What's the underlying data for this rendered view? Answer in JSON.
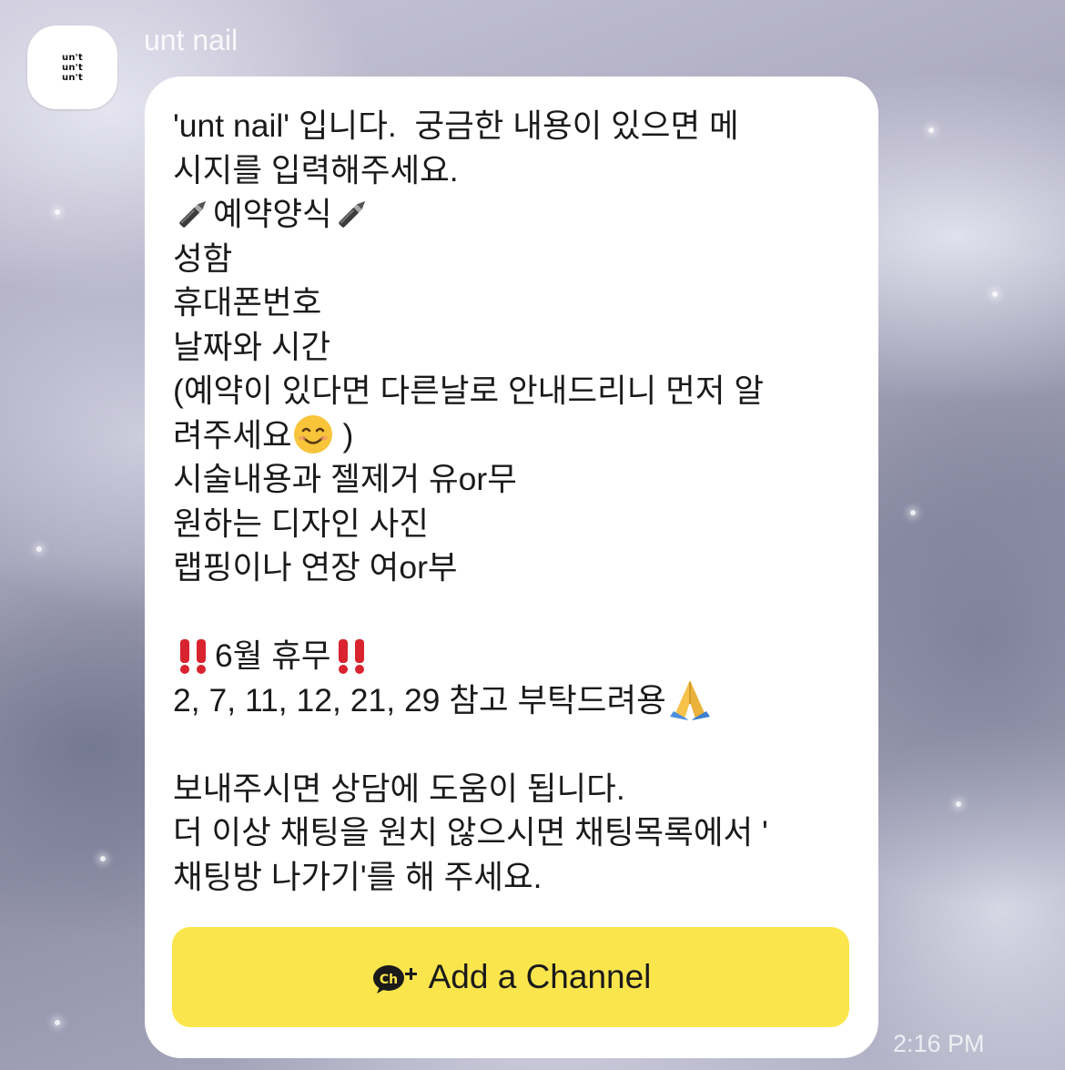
{
  "chat": {
    "sender_name": "unt nail",
    "avatar_text": [
      "un't",
      "un't",
      "un't"
    ],
    "timestamp": "2:16 PM"
  },
  "message": {
    "line1": "'unt nail' 입니다.  궁금한 내용이 있으면 메",
    "line2": "시지를 입력해주세요.",
    "line3_text": "예약양식",
    "line4": "성함",
    "line5": "휴대폰번호",
    "line6": "날짜와 시간",
    "line7": "(예약이 있다면 다른날로 안내드리니 먼저 알",
    "line8_text": "려주세요",
    "line8_end": " )",
    "line9": "시술내용과 젤제거 유or무",
    "line10": "원하는 디자인 사진",
    "line11": "랩핑이나 연장 여or부",
    "line13_text": "6월 휴무",
    "line14_text": "2, 7, 11, 12, 21, 29 참고 부탁드려용",
    "line16": "보내주시면 상담에 도움이 됩니다.",
    "line17": "더 이상 채팅을 원치 않으시면 채팅목록에서 '",
    "line18": "채팅방 나가기'를 해 주세요."
  },
  "actions": {
    "add_channel_label": "Add a Channel",
    "add_channel_icon": "kakao-channel-plus-icon",
    "add_channel_color": "#fbe54d"
  },
  "icons": {
    "pen": "fountain-pen-icon",
    "smile": "smiling-face-icon",
    "exclamation": "double-exclamation-icon",
    "pray": "folded-hands-icon"
  }
}
